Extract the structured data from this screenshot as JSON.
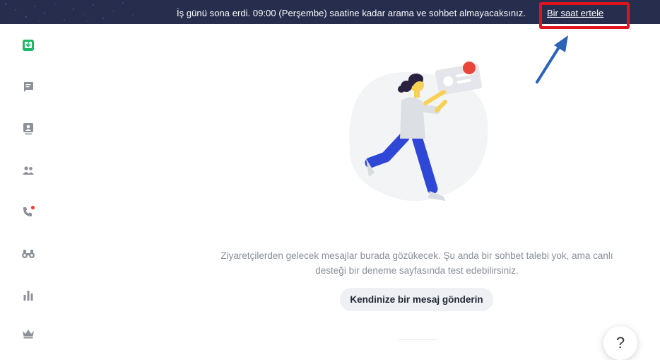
{
  "banner": {
    "message": "İş günü sona erdi. 09:00 (Perşembe) saatine kadar arama ve sohbet almayacaksınız.",
    "snooze_link": "Bir saat ertele"
  },
  "sidebar": {
    "items": [
      {
        "icon": "inbox-download-icon",
        "active": true
      },
      {
        "icon": "chat-bubble-icon"
      },
      {
        "icon": "contacts-card-icon"
      },
      {
        "icon": "visitors-icon"
      },
      {
        "icon": "phone-icon",
        "badge": true
      },
      {
        "icon": "binoculars-icon"
      },
      {
        "icon": "bar-chart-icon"
      },
      {
        "icon": "crown-icon"
      }
    ]
  },
  "main": {
    "empty_message": "Ziyaretçilerden gelecek mesajlar burada gözükecek. Şu anda bir sohbet talebi yok, ama canlı desteği bir deneme sayfasında test edebilirsiniz.",
    "send_button": "Kendinize bir mesaj gönderin"
  },
  "help": {
    "label": "?"
  },
  "colors": {
    "banner_bg": "#262d4d",
    "highlight": "#e0141e",
    "accent_green": "#21b566",
    "icon_gray": "#8c9099",
    "badge_red": "#e8443a",
    "illustration_blue": "#2f47d6"
  }
}
